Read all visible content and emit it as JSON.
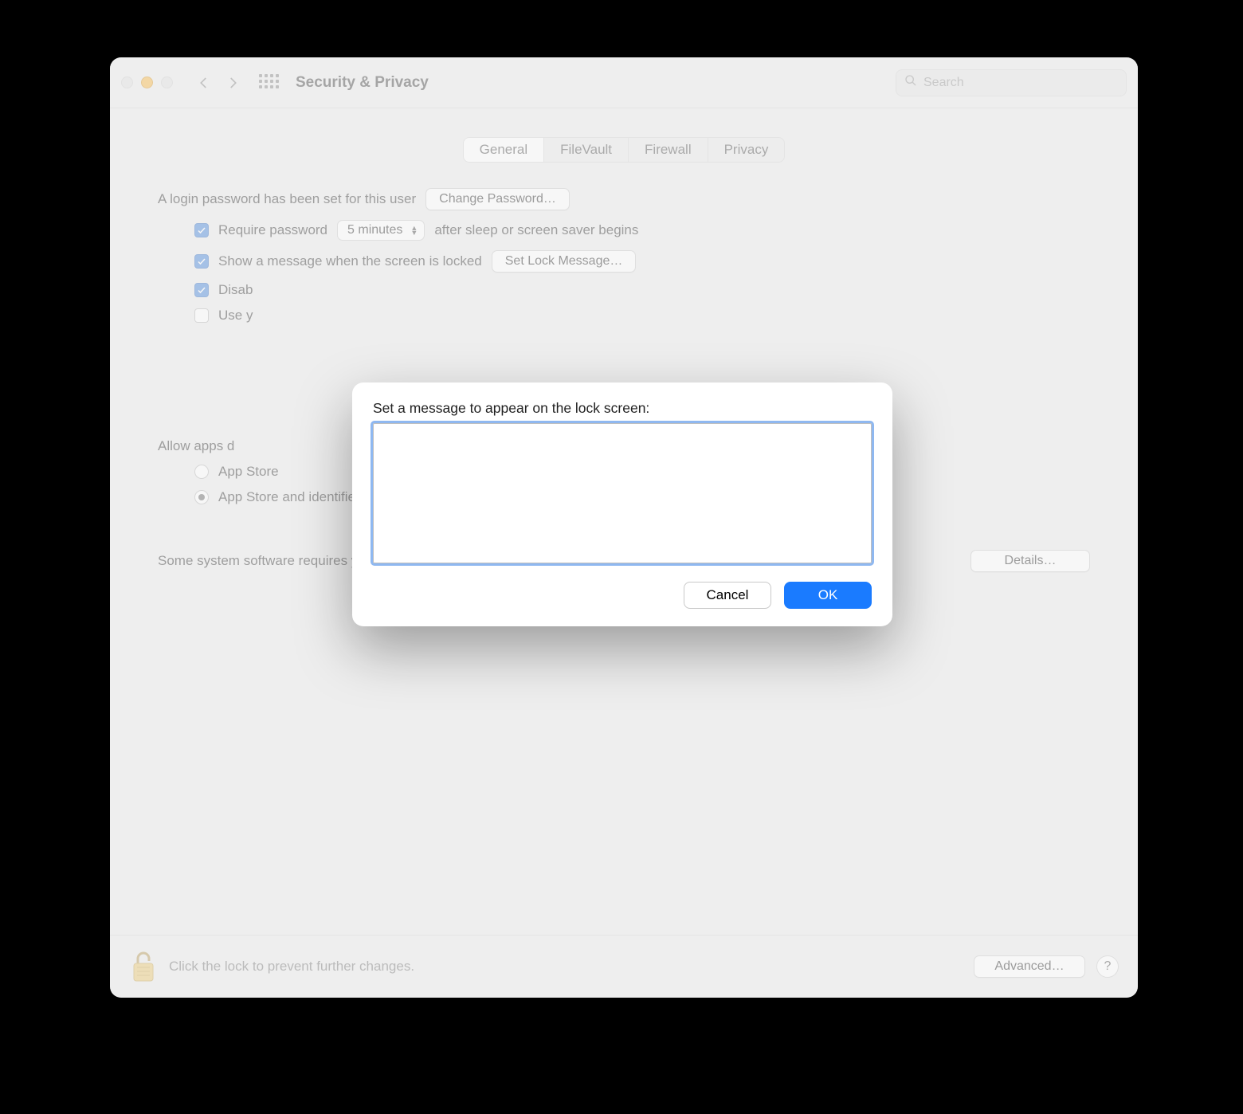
{
  "window": {
    "title": "Security & Privacy",
    "search_placeholder": "Search"
  },
  "tabs": [
    {
      "label": "General",
      "active": true
    },
    {
      "label": "FileVault",
      "active": false
    },
    {
      "label": "Firewall",
      "active": false
    },
    {
      "label": "Privacy",
      "active": false
    }
  ],
  "general": {
    "login_password_text": "A login password has been set for this user",
    "change_password_btn": "Change Password…",
    "require_password": {
      "checked": true,
      "label_pre": "Require password",
      "delay_selected": "5 minutes",
      "label_post": "after sleep or screen saver begins"
    },
    "show_lock_message": {
      "checked": true,
      "label": "Show a message when the screen is locked",
      "button": "Set Lock Message…"
    },
    "disable_auto_login": {
      "checked": true,
      "label_visible": "Disab"
    },
    "use_apple_watch": {
      "checked": false,
      "label_visible": "Use y"
    },
    "allow_apps": {
      "heading_visible": "Allow apps d",
      "options": [
        {
          "label": "App Store",
          "selected": false
        },
        {
          "label": "App Store and identified developers",
          "selected": true
        }
      ]
    },
    "attention_notice": "Some system software requires your attention before it can be used.",
    "details_btn": "Details…"
  },
  "footer": {
    "lock_text": "Click the lock to prevent further changes.",
    "advanced_btn": "Advanced…",
    "help_symbol": "?"
  },
  "modal": {
    "label": "Set a message to appear on the lock screen:",
    "value": "",
    "cancel": "Cancel",
    "ok": "OK"
  }
}
